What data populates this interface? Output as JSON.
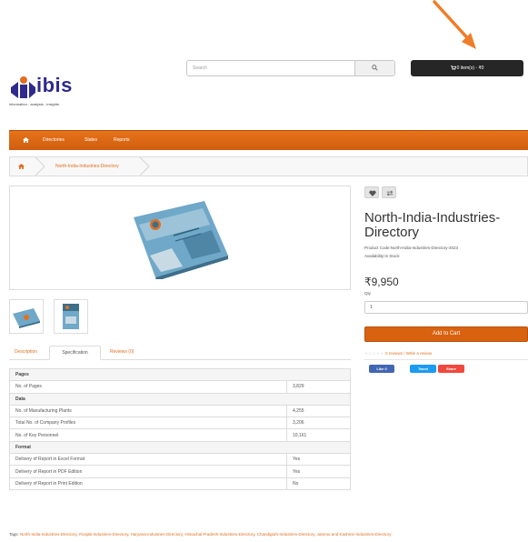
{
  "header": {
    "logo_text": "ibis",
    "logo_tagline": "information - analysis - insights",
    "search_placeholder": "Search",
    "cart_label": "0 item(s) - ₹0"
  },
  "nav": {
    "items": [
      "Directories",
      "States",
      "Reports"
    ]
  },
  "breadcrumb": {
    "current": "North-India-Industries-Directory"
  },
  "tabs": [
    "Description",
    "Specification",
    "Reviews (0)"
  ],
  "spec": {
    "sections": [
      {
        "title": "Pages",
        "rows": [
          {
            "label": "No. of Pages",
            "value": "3,829"
          }
        ]
      },
      {
        "title": "Data",
        "rows": [
          {
            "label": "No. of Manufacturing Plants",
            "value": "4,255"
          },
          {
            "label": "Total No. of Company Profiles",
            "value": "3,206"
          },
          {
            "label": "No. of Key Personnel",
            "value": "10,161"
          }
        ]
      },
      {
        "title": "Format",
        "rows": [
          {
            "label": "Delivery of Report in Excel Format",
            "value": "Yes"
          },
          {
            "label": "Delivery of Report in PDF Edition",
            "value": "Yes"
          },
          {
            "label": "Delivery of Report in Print Edition",
            "value": "No"
          }
        ]
      }
    ]
  },
  "product": {
    "title_line1": "North-India-Industries-",
    "title_line2": "Directory",
    "code": "Product Code:North-India-Industries-Directory-2023",
    "availability": "Availability:In Stock",
    "price": "₹9,950",
    "qty_label": "Qty",
    "qty_value": "1",
    "add_to_cart": "Add to Cart",
    "reviews_text": "0 reviews / Write a review"
  },
  "social": {
    "like": "Like 0",
    "tweet": "Tweet",
    "share": "Share"
  },
  "tags": {
    "label": "Tags:",
    "items": "North-India-Industries-Directory, Punjab-Industries-Directory, Haryana-Industries-Directory, Himachal Pradesh-Industries-Directory, Chandigarh-Industries-Directory, Jammu and Kashmir-Industries-Directory"
  },
  "colors": {
    "accent": "#d8620f",
    "nav": "#e26d17",
    "cart": "#262626",
    "link": "#e07020",
    "logo": "#2f2a8c"
  }
}
